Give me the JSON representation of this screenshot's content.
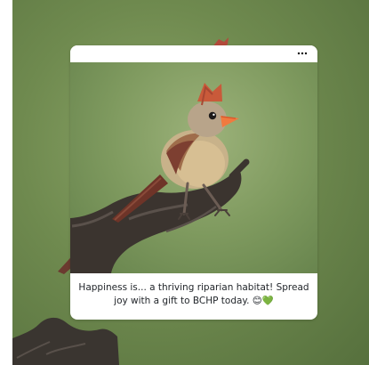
{
  "post": {
    "caption": "Happiness is... a thriving riparian habitat! Spread joy with a gift to BCHP today. 😊💚"
  },
  "icons": {
    "more": "more-horizontal-icon"
  }
}
